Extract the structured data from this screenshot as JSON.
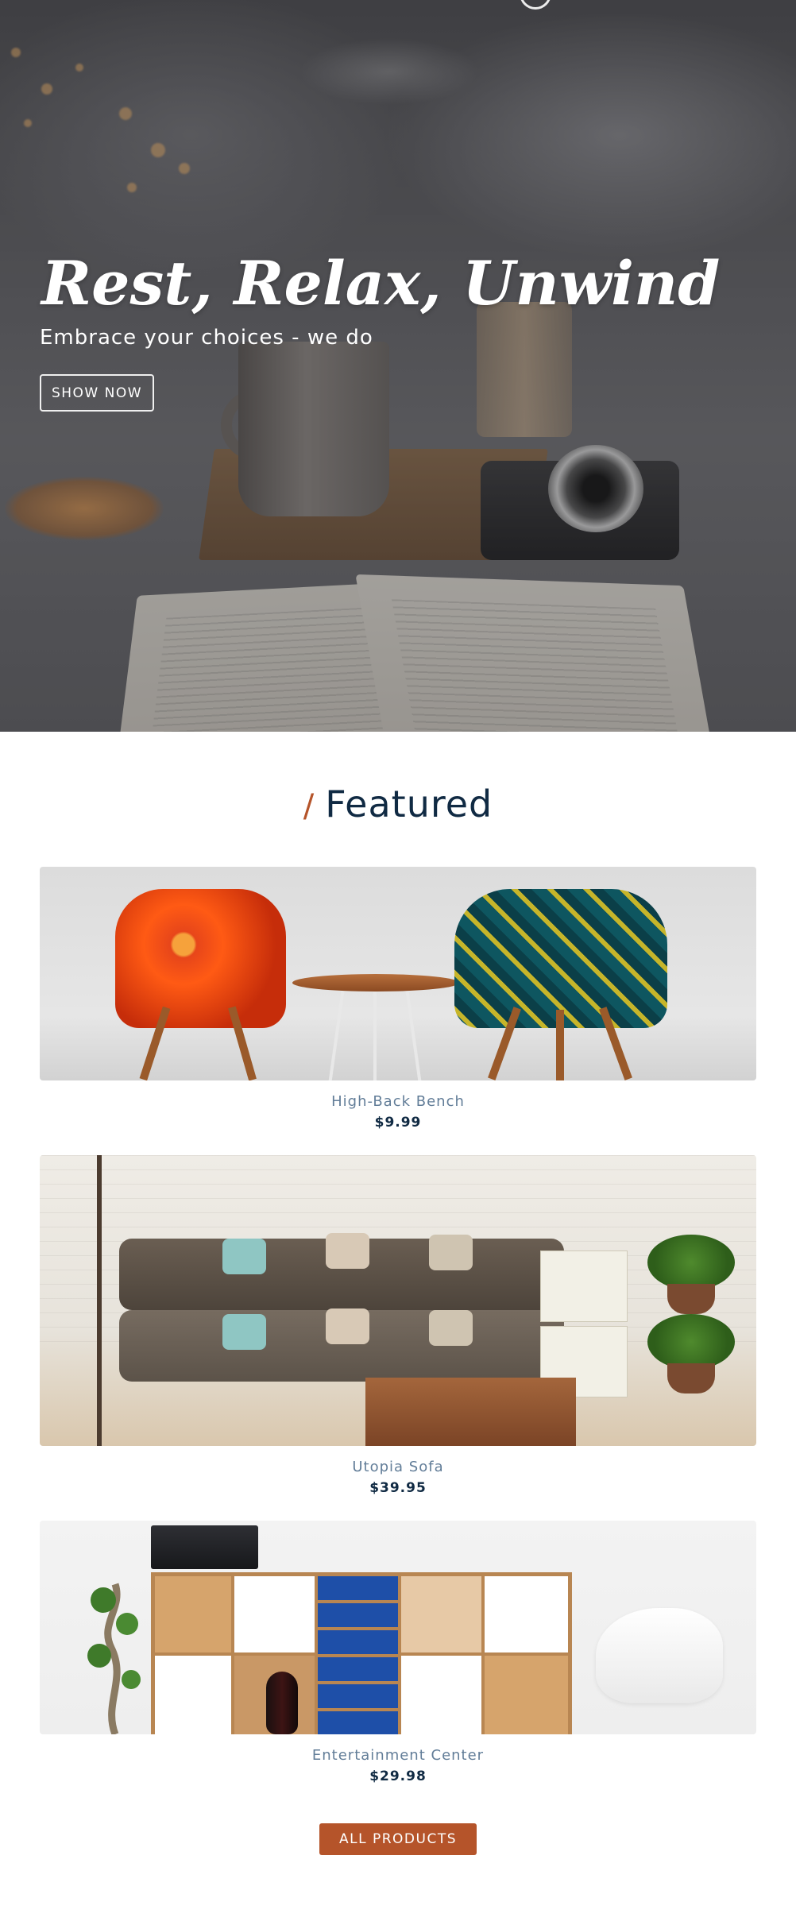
{
  "hero": {
    "title": "Rest, Relax, Unwind",
    "subtitle": "Embrace your choices - we do",
    "button_label": "SHOW NOW"
  },
  "featured": {
    "slash": "/",
    "title": "Featured",
    "products": [
      {
        "name": "High-Back Bench",
        "price": "$9.99"
      },
      {
        "name": "Utopia Sofa",
        "price": "$39.95"
      },
      {
        "name": "Entertainment Center",
        "price": "$29.98"
      }
    ],
    "all_button_label": "ALL PRODUCTS"
  },
  "colors": {
    "accent": "#b5542a",
    "heading": "#102a43",
    "product_name": "#627d98"
  }
}
